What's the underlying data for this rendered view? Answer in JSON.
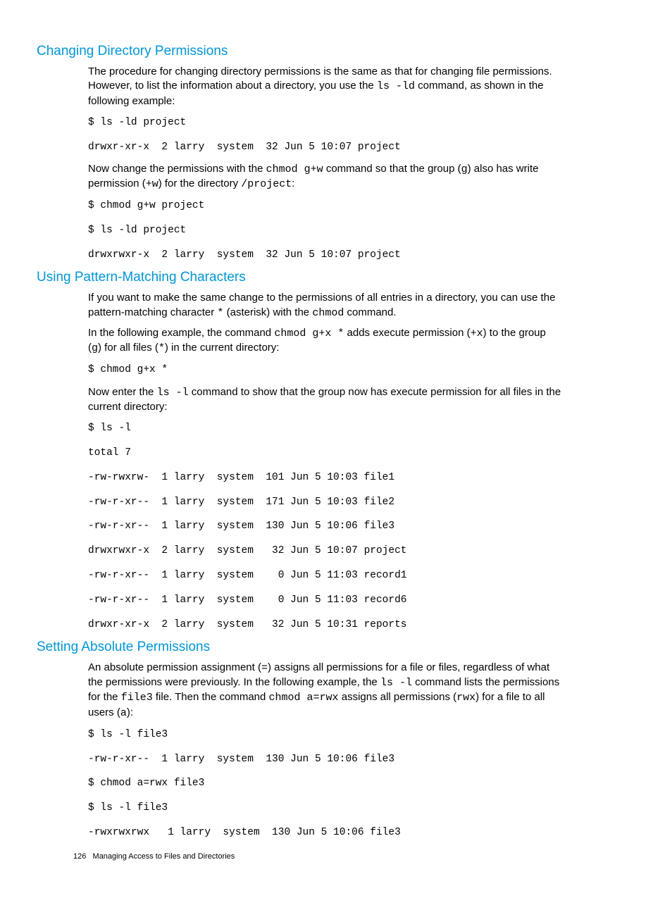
{
  "section1": {
    "heading": "Changing Directory Permissions",
    "p1a": "The procedure for changing directory permissions is the same as that for changing file permissions. However, to list the information about a directory, you use the ",
    "p1b": "ls -ld",
    "p1c": " command, as shown in the following example:",
    "code1": "$ ls -ld project\n\ndrwxr-xr-x  2 larry  system  32 Jun 5 10:07 project",
    "p2a": "Now change the permissions with the ",
    "p2b": "chmod g+w",
    "p2c": " command so that the group (",
    "p2d": "g",
    "p2e": ") also has write permission (",
    "p2f": "+w",
    "p2g": ") for the directory ",
    "p2h": "/project",
    "p2i": ":",
    "code2": "$ chmod g+w project\n\n$ ls -ld project\n\ndrwxrwxr-x  2 larry  system  32 Jun 5 10:07 project"
  },
  "section2": {
    "heading": "Using Pattern-Matching Characters",
    "p1a": "If you want to make the same change to the permissions of all entries in a directory, you can use the pattern-matching character ",
    "p1b": "*",
    "p1c": " (asterisk) with the ",
    "p1d": "chmod",
    "p1e": " command.",
    "p2a": "In the following example, the command ",
    "p2b": "chmod g+x *",
    "p2c": " adds execute permission (",
    "p2d": "+x",
    "p2e": ") to the group (",
    "p2f": "g",
    "p2g": ") for all files (",
    "p2h": "*",
    "p2i": ") in the current directory:",
    "code1": "$ chmod g+x *",
    "p3a": "Now enter the ",
    "p3b": "ls -l",
    "p3c": " command to show that the group now has execute permission for all files in the current directory:",
    "code2": "$ ls -l\n\ntotal 7\n\n-rw-rwxrw-  1 larry  system  101 Jun 5 10:03 file1\n\n-rw-r-xr--  1 larry  system  171 Jun 5 10:03 file2\n\n-rw-r-xr--  1 larry  system  130 Jun 5 10:06 file3\n\ndrwxrwxr-x  2 larry  system   32 Jun 5 10:07 project\n\n-rw-r-xr--  1 larry  system    0 Jun 5 11:03 record1\n\n-rw-r-xr--  1 larry  system    0 Jun 5 11:03 record6\n\ndrwxr-xr-x  2 larry  system   32 Jun 5 10:31 reports"
  },
  "section3": {
    "heading": "Setting Absolute Permissions",
    "p1a": "An absolute permission assignment (",
    "p1b": "=",
    "p1c": ") assigns all permissions for a file or files, regardless of what the permissions were previously. In the following example, the ",
    "p1d": "ls -l",
    "p1e": " command lists the permissions for the ",
    "p1f": "file3",
    "p1g": " file. Then the command ",
    "p1h": "chmod a=rwx",
    "p1i": " assigns all permissions (",
    "p1j": "rwx",
    "p1k": ") for a file to all users (",
    "p1l": "a",
    "p1m": "):",
    "code1": "$ ls -l file3\n\n-rw-r-xr--  1 larry  system  130 Jun 5 10:06 file3\n\n$ chmod a=rwx file3\n\n$ ls -l file3\n\n-rwxrwxrwx   1 larry  system  130 Jun 5 10:06 file3"
  },
  "footer": {
    "page": "126",
    "title": "Managing Access to Files and Directories"
  }
}
